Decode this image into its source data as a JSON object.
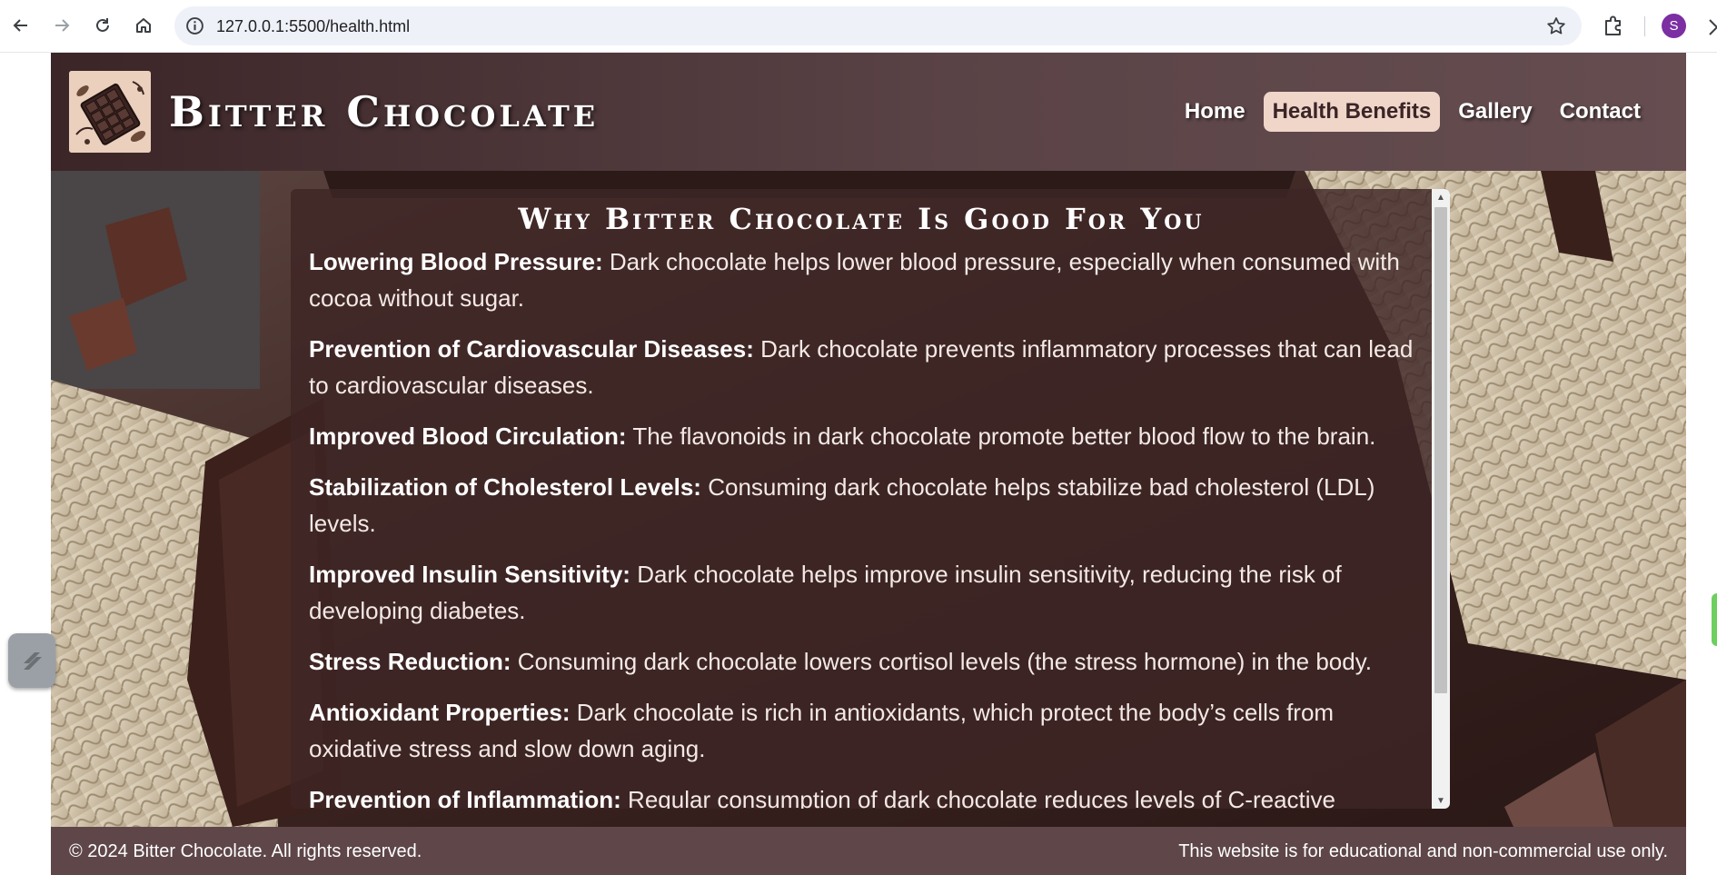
{
  "browser": {
    "url": "127.0.0.1:5500/health.html",
    "profile_initial": "S",
    "icons": [
      "back-icon",
      "forward-icon",
      "reload-icon",
      "home-icon",
      "site-info-icon",
      "star-icon",
      "extensions-icon"
    ]
  },
  "site": {
    "title": "Bitter Chocolate",
    "nav": [
      {
        "label": "Home",
        "active": false
      },
      {
        "label": "Health Benefits",
        "active": true
      },
      {
        "label": "Gallery",
        "active": false
      },
      {
        "label": "Contact",
        "active": false
      }
    ]
  },
  "content": {
    "heading": "Why Bitter Chocolate Is Good For You",
    "benefits": [
      {
        "title": "Lowering Blood Pressure:",
        "text": "Dark chocolate helps lower blood pressure, especially when consumed with cocoa without sugar."
      },
      {
        "title": "Prevention of Cardiovascular Diseases:",
        "text": "Dark chocolate prevents inflammatory processes that can lead to cardiovascular diseases."
      },
      {
        "title": "Improved Blood Circulation:",
        "text": "The flavonoids in dark chocolate promote better blood flow to the brain."
      },
      {
        "title": "Stabilization of Cholesterol Levels:",
        "text": "Consuming dark chocolate helps stabilize bad cholesterol (LDL) levels."
      },
      {
        "title": "Improved Insulin Sensitivity:",
        "text": "Dark chocolate helps improve insulin sensitivity, reducing the risk of developing diabetes."
      },
      {
        "title": "Stress Reduction:",
        "text": "Consuming dark chocolate lowers cortisol levels (the stress hormone) in the body."
      },
      {
        "title": "Antioxidant Properties:",
        "text": "Dark chocolate is rich in antioxidants, which protect the body’s cells from oxidative stress and slow down aging."
      },
      {
        "title": "Prevention of Inflammation:",
        "text": "Regular consumption of dark chocolate reduces levels of C-reactive protein in"
      }
    ]
  },
  "footer": {
    "copyright": "© 2024 Bitter Chocolate. All rights reserved.",
    "notice": "This website is for educational and non-commercial use only."
  },
  "colors": {
    "header_bg": "#5a4346",
    "active_nav_bg": "#f0d6c9",
    "content_box_bg": "#3e2626",
    "footer_bg": "#5e4649",
    "profile_bg": "#7b2fa3"
  }
}
